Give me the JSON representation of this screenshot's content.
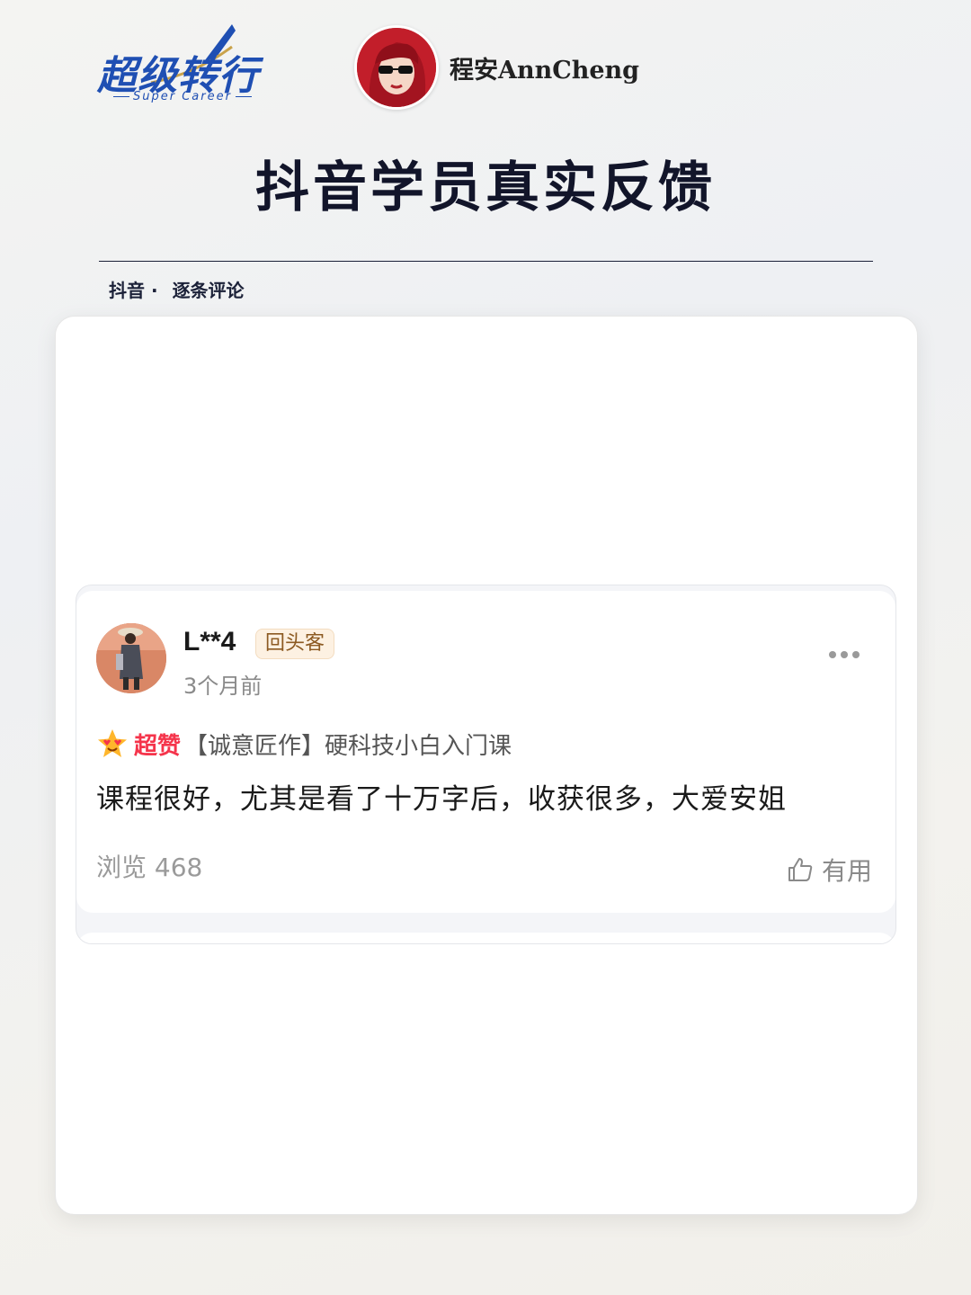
{
  "brand": {
    "logo_text": "超级转行",
    "logo_subtitle": "Super Career",
    "accent_color": "#1f4fb3"
  },
  "author": {
    "name": "程安AnnCheng"
  },
  "page": {
    "title": "抖音学员真实反馈",
    "subline_source": "抖音 ·",
    "subline_detail": "逐条评论"
  },
  "comment": {
    "username": "L**4",
    "badge": "回头客",
    "time": "3个月前",
    "rating_icon": "star-heart-eyes-icon",
    "rating_label": "超赞",
    "product": "【诚意匠作】硬科技小白入门课",
    "text": "课程很好，尤其是看了十万字后，收获很多，大爱安姐",
    "views": "浏览 468",
    "useful_label": "有用",
    "rating_color": "#f5344b"
  }
}
